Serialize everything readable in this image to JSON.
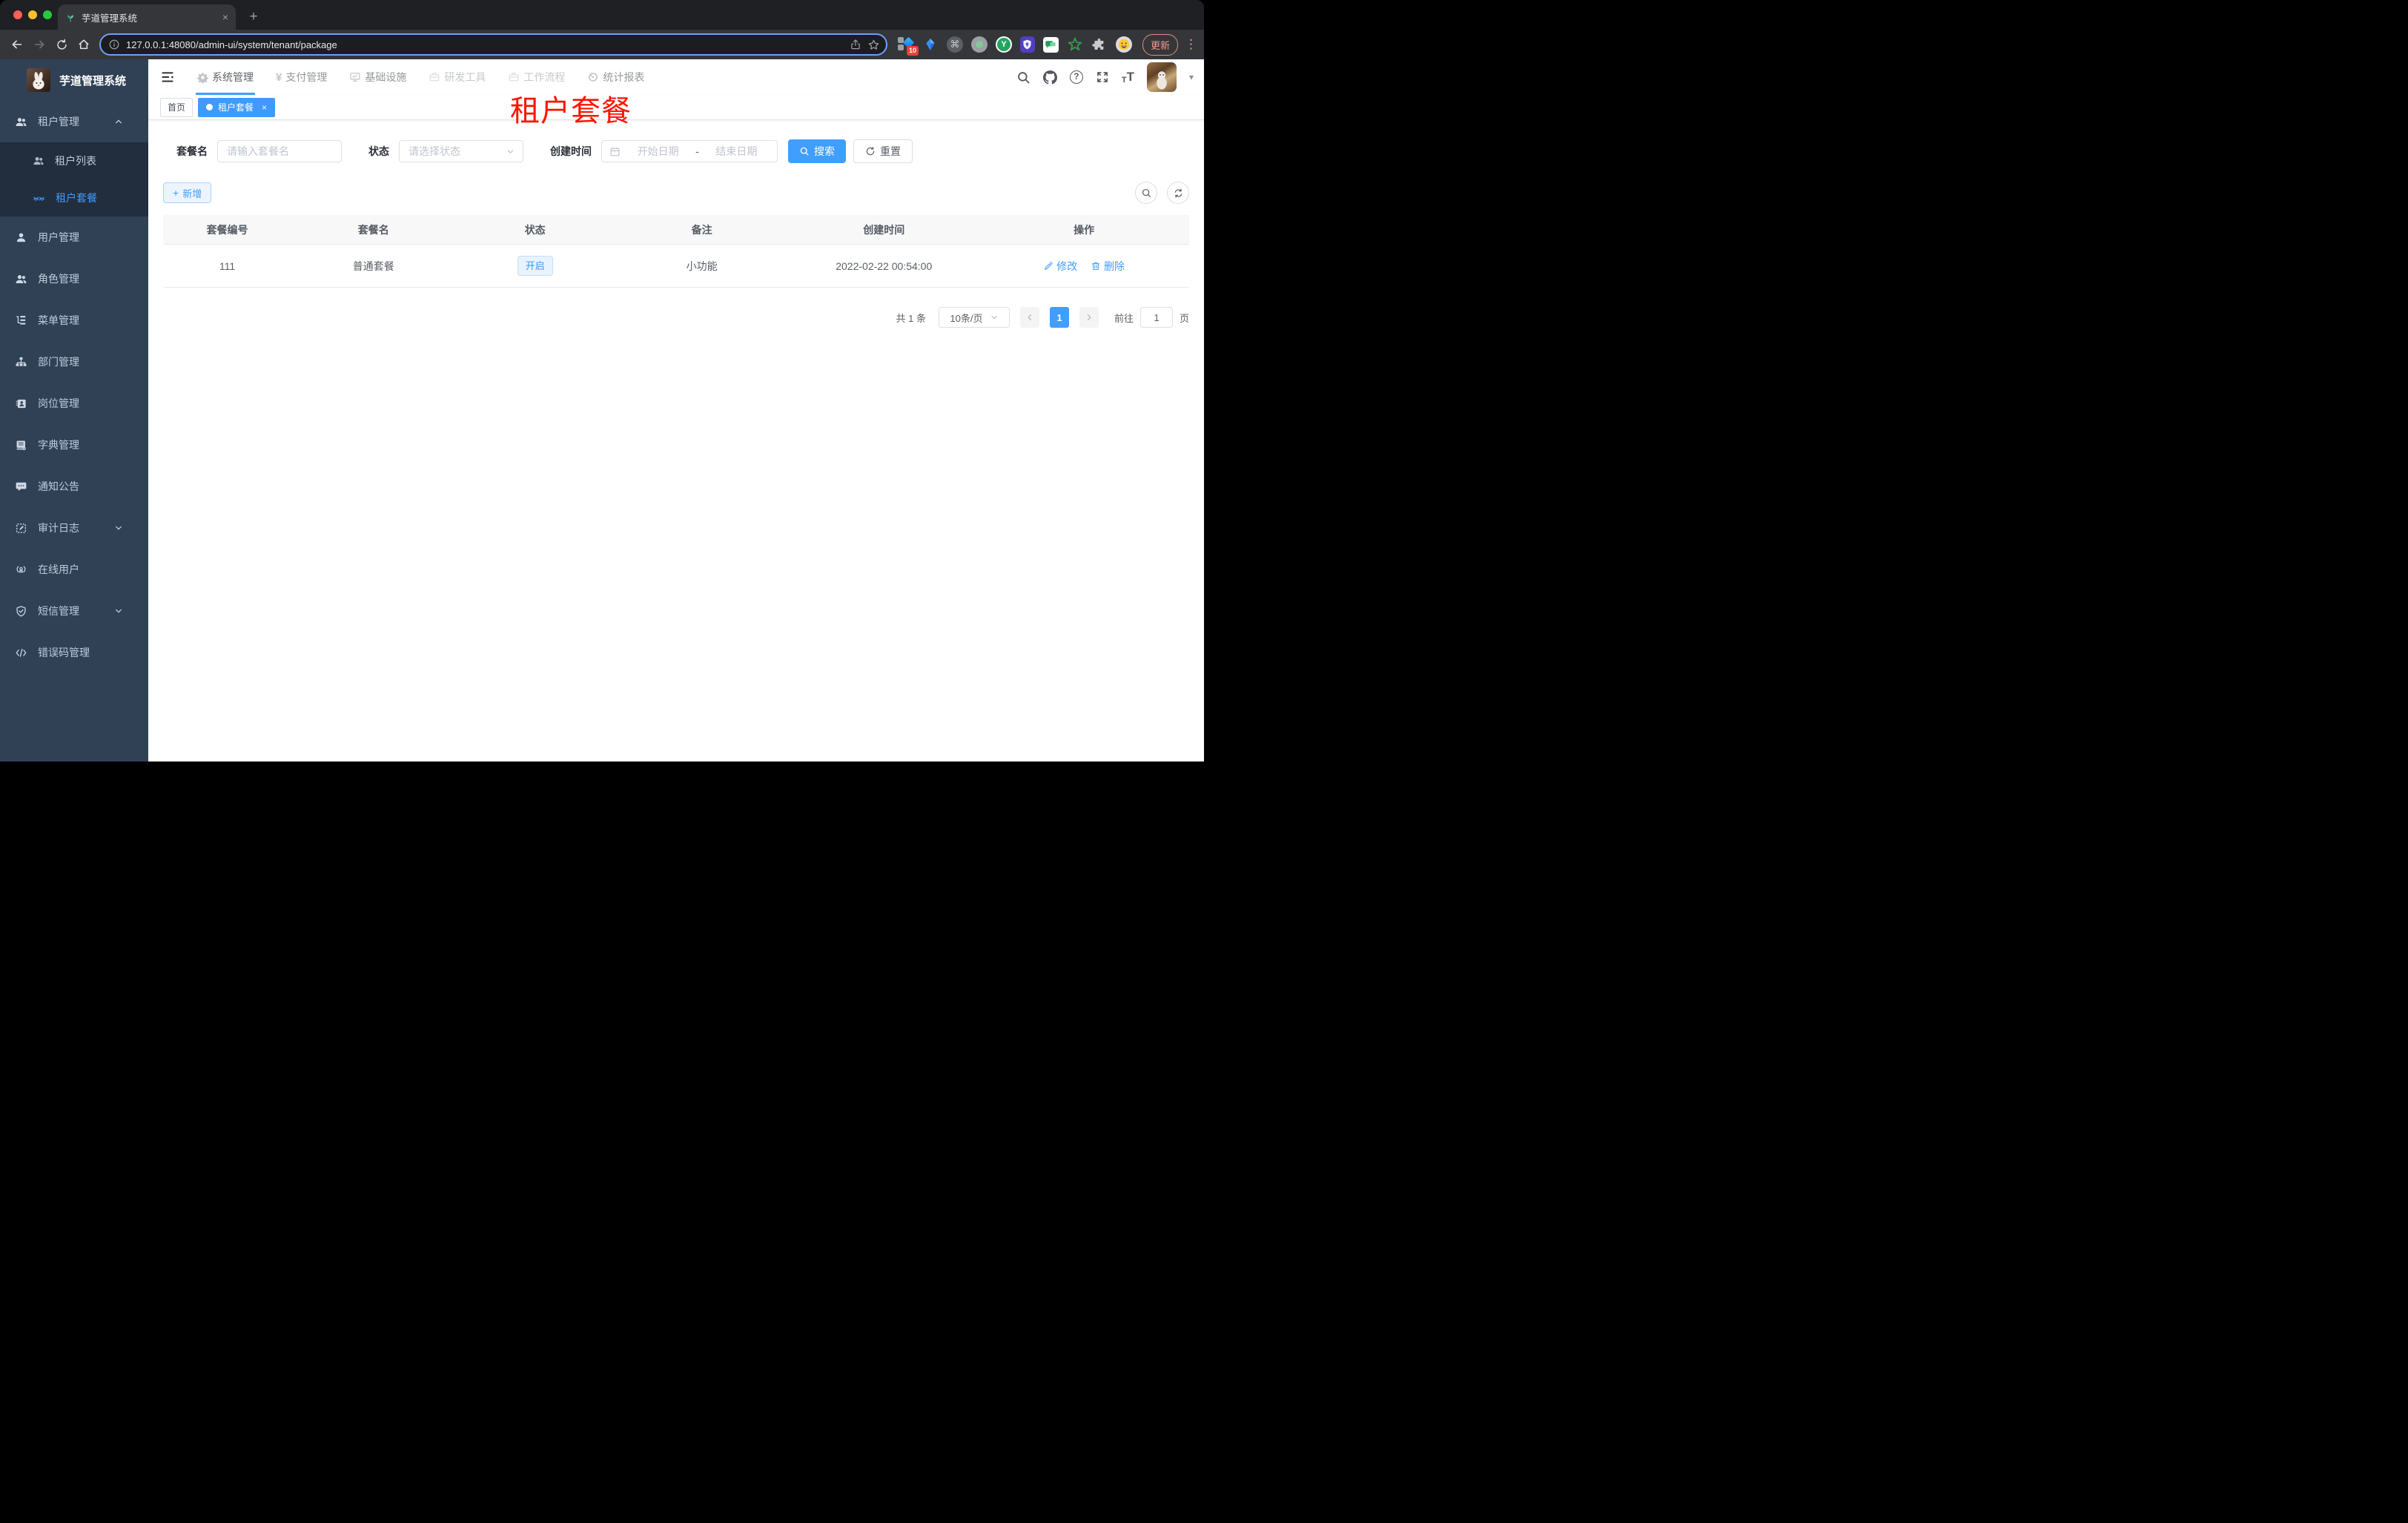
{
  "browser": {
    "tab_title": "芋道管理系统",
    "url": "127.0.0.1:48080/admin-ui/system/tenant/package",
    "update_label": "更新",
    "extension_badge": "10",
    "glyphs": {
      "new_tab": "+",
      "tab_close": "×",
      "cmd": "⌘",
      "kebab": "⋮",
      "y_logo": "Y"
    }
  },
  "appbar": {
    "nav": {
      "system": "系统管理",
      "pay": "支付管理",
      "infra": "基础设施",
      "dev": "研发工具",
      "flow": "工作流程",
      "report": "统计报表"
    },
    "glyphs": {
      "yen": "¥",
      "help": "?",
      "font_small": "T",
      "font_big": "T",
      "caret": "▾"
    }
  },
  "sidebar": {
    "logo_title": "芋道管理系统",
    "items": {
      "tenant": "租户管理",
      "tenant_list": "租户列表",
      "tenant_package": "租户套餐",
      "user": "用户管理",
      "role": "角色管理",
      "menu": "菜单管理",
      "dept": "部门管理",
      "post": "岗位管理",
      "dict": "字典管理",
      "notice": "通知公告",
      "audit": "审计日志",
      "online": "在线用户",
      "sms": "短信管理",
      "errcode": "错误码管理"
    }
  },
  "tags": {
    "home": "首页",
    "active": "租户套餐",
    "close": "×"
  },
  "annotation": {
    "text": "租户套餐",
    "color": "#fd1400"
  },
  "search": {
    "name_label": "套餐名",
    "name_placeholder": "请输入套餐名",
    "status_label": "状态",
    "status_placeholder": "请选择状态",
    "date_label": "创建时间",
    "date_start": "开始日期",
    "date_sep": "-",
    "date_end": "结束日期",
    "search_button": "搜索",
    "reset_button": "重置"
  },
  "toolbar": {
    "add_button": "新增",
    "add_plus": "+"
  },
  "table": {
    "columns": {
      "id": "套餐编号",
      "name": "套餐名",
      "status": "状态",
      "remark": "备注",
      "created": "创建时间",
      "actions": "操作"
    },
    "row": {
      "id": "111",
      "name": "普通套餐",
      "status": "开启",
      "remark": "小功能",
      "created": "2022-02-22 00:54:00",
      "edit": "修改",
      "del": "删除"
    }
  },
  "pagination": {
    "total": "共 1 条",
    "page_size": "10条/页",
    "page": "1",
    "goto": "前往",
    "goto_value": "1",
    "unit": "页"
  },
  "colors": {
    "accent": "#409eff",
    "sidebar_bg": "#304156",
    "submenu_bg": "#222d3d",
    "annotation_red": "#fd1400"
  }
}
